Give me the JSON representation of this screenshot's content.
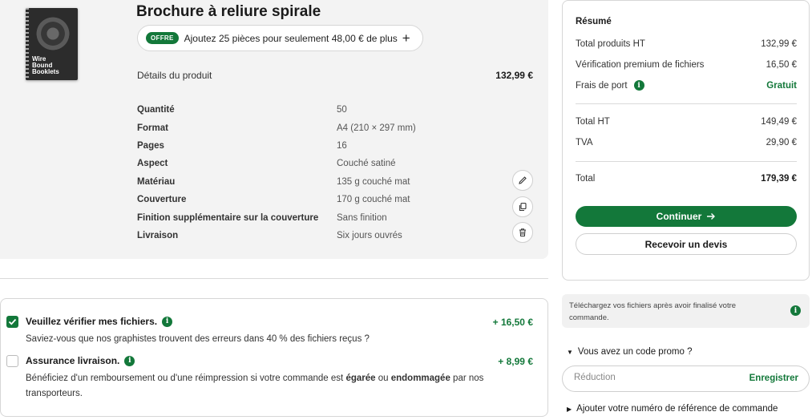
{
  "product": {
    "title": "Brochure à reliure spirale",
    "thumbnail_caption": "Wire\nBound\nBooklets",
    "offer_badge": "OFFRE",
    "offer_text": "Ajoutez 25 pièces pour seulement 48,00 € de plus",
    "details_label": "Détails du produit",
    "details_price": "132,99 €",
    "specs": [
      {
        "label": "Quantité",
        "value": "50"
      },
      {
        "label": "Format",
        "value": "A4 (210 × 297 mm)"
      },
      {
        "label": "Pages",
        "value": "16"
      },
      {
        "label": "Aspect",
        "value": "Couché satiné"
      },
      {
        "label": "Matériau",
        "value": "135 g couché mat"
      },
      {
        "label": "Couverture",
        "value": "170 g couché mat"
      },
      {
        "label": "Finition supplémentaire sur la couverture",
        "value": "Sans finition"
      },
      {
        "label": "Livraison",
        "value": "Six jours ouvrés"
      }
    ],
    "actions": [
      "edit-icon",
      "copy-icon",
      "trash-icon"
    ]
  },
  "options": [
    {
      "title": "Veuillez vérifier mes fichiers.",
      "description": "Saviez-vous que nos graphistes trouvent des erreurs dans 40 % des fichiers reçus ?",
      "price": "+ 16,50 €",
      "checked": true
    },
    {
      "title": "Assurance livraison.",
      "description_before": "Bénéficiez d'un remboursement ou d'une réimpression si votre commande est ",
      "description_bold1": "égarée",
      "description_mid": " ou ",
      "description_bold2": "endommagée",
      "description_after": " par nos transporteurs.",
      "price": "+ 8,99 €",
      "checked": false
    }
  ],
  "summary": {
    "heading": "Résumé",
    "rows": [
      {
        "label": "Total produits HT",
        "value": "132,99 €"
      },
      {
        "label": "Vérification premium de fichiers",
        "value": "16,50 €"
      },
      {
        "label": "Frais de port",
        "value": "Gratuit"
      }
    ],
    "subtotal_rows": [
      {
        "label": "Total HT",
        "value": "149,49 €"
      },
      {
        "label": "TVA",
        "value": "29,90 €"
      }
    ],
    "total_label": "Total",
    "total_value": "179,39 €",
    "continue_label": "Continuer",
    "quote_label": "Recevoir un devis"
  },
  "notice": "Téléchargez vos fichiers après avoir finalisé votre commande.",
  "promo": {
    "toggle_label": "Vous avez un code promo ?",
    "placeholder": "Réduction",
    "save_label": "Enregistrer"
  },
  "reference_toggle_label": "Ajouter votre numéro de référence de commande",
  "colors": {
    "accent": "#13783a",
    "panel": "#f3f3f3",
    "border": "#d6d6d6"
  }
}
